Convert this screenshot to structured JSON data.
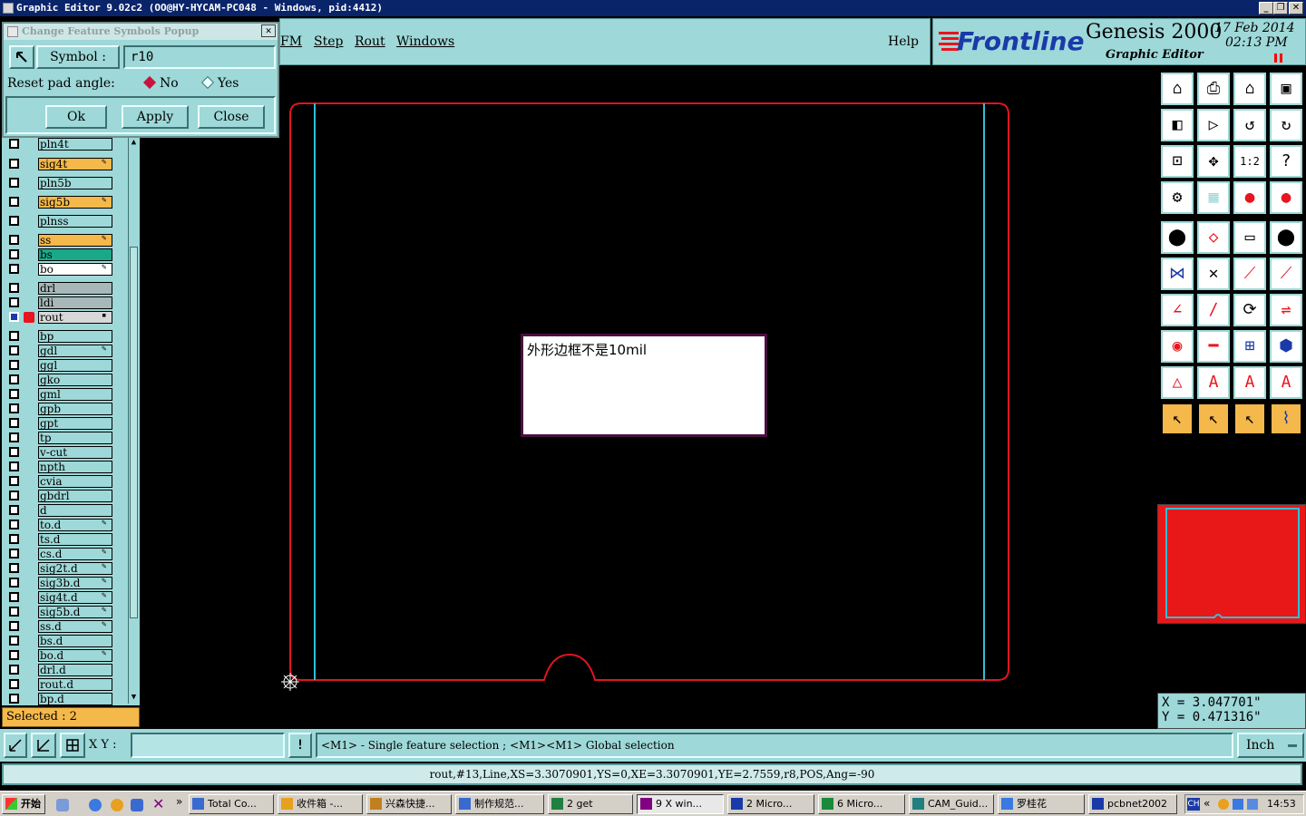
{
  "window": {
    "title": "Graphic Editor 9.02c2 (OO@HY-HYCAM-PC048 - Windows, pid:4412)"
  },
  "menu": {
    "items": [
      "FM",
      "Step",
      "Rout",
      "Windows"
    ],
    "help": "Help"
  },
  "brand": {
    "logo": "Frontline",
    "product": "Genesis 2000",
    "subtitle": "Graphic Editor",
    "date": "17 Feb 2014",
    "time": "02:13 PM"
  },
  "popup": {
    "title": "Change Feature Symbols Popup",
    "symbol_label": "Symbol :",
    "symbol_value": "r10",
    "reset_label": "Reset pad angle:",
    "opt_no": "No",
    "opt_yes": "Yes",
    "ok": "Ok",
    "apply": "Apply",
    "close": "Close"
  },
  "layers": [
    {
      "name": "pln4t",
      "color": "#9ed8d8",
      "flag": ""
    },
    {
      "name": "sig4t",
      "color": "#f5b84a",
      "flag": "✎"
    },
    {
      "name": "pln5b",
      "color": "#9ed8d8",
      "flag": ""
    },
    {
      "name": "sig5b",
      "color": "#f5b84a",
      "flag": "✎"
    },
    {
      "name": "plnss",
      "color": "#9ed8d8",
      "flag": ""
    },
    {
      "name": "ss",
      "color": "#f5b84a",
      "flag": "✎"
    },
    {
      "name": "bs",
      "color": "#1aa88a",
      "flag": ""
    },
    {
      "name": "bo",
      "color": "#ffffff",
      "flag": "✎"
    },
    {
      "name": "drl",
      "color": "#a8b8b8",
      "flag": ""
    },
    {
      "name": "ldi",
      "color": "#a8b8b8",
      "flag": ""
    },
    {
      "name": "rout",
      "color": "#d8d8d8",
      "flag": "▪"
    },
    {
      "name": "bp",
      "color": "#9ed8d8",
      "flag": ""
    },
    {
      "name": "gdl",
      "color": "#9ed8d8",
      "flag": "✎"
    },
    {
      "name": "ggl",
      "color": "#9ed8d8",
      "flag": ""
    },
    {
      "name": "gko",
      "color": "#9ed8d8",
      "flag": ""
    },
    {
      "name": "gml",
      "color": "#9ed8d8",
      "flag": ""
    },
    {
      "name": "gpb",
      "color": "#9ed8d8",
      "flag": ""
    },
    {
      "name": "gpt",
      "color": "#9ed8d8",
      "flag": ""
    },
    {
      "name": "tp",
      "color": "#9ed8d8",
      "flag": ""
    },
    {
      "name": "v-cut",
      "color": "#9ed8d8",
      "flag": ""
    },
    {
      "name": "npth",
      "color": "#9ed8d8",
      "flag": ""
    },
    {
      "name": "cvia",
      "color": "#9ed8d8",
      "flag": ""
    },
    {
      "name": "gbdrl",
      "color": "#9ed8d8",
      "flag": ""
    },
    {
      "name": "d",
      "color": "#9ed8d8",
      "flag": ""
    },
    {
      "name": "to.d",
      "color": "#9ed8d8",
      "flag": "✎"
    },
    {
      "name": "ts.d",
      "color": "#9ed8d8",
      "flag": ""
    },
    {
      "name": "cs.d",
      "color": "#9ed8d8",
      "flag": "✎"
    },
    {
      "name": "sig2t.d",
      "color": "#9ed8d8",
      "flag": "✎"
    },
    {
      "name": "sig3b.d",
      "color": "#9ed8d8",
      "flag": "✎"
    },
    {
      "name": "sig4t.d",
      "color": "#9ed8d8",
      "flag": "✎"
    },
    {
      "name": "sig5b.d",
      "color": "#9ed8d8",
      "flag": "✎"
    },
    {
      "name": "ss.d",
      "color": "#9ed8d8",
      "flag": "✎"
    },
    {
      "name": "bs.d",
      "color": "#9ed8d8",
      "flag": ""
    },
    {
      "name": "bo.d",
      "color": "#9ed8d8",
      "flag": "✎"
    },
    {
      "name": "drl.d",
      "color": "#9ed8d8",
      "flag": ""
    },
    {
      "name": "rout.d",
      "color": "#9ed8d8",
      "flag": ""
    },
    {
      "name": "bp.d",
      "color": "#9ed8d8",
      "flag": ""
    }
  ],
  "selected": "Selected : 2",
  "message_box": {
    "text": "外形边框不是10mil"
  },
  "coords": {
    "x": "X = 3.047701\"",
    "y": "Y = 0.471316\""
  },
  "bottom": {
    "xy_label": "X Y :",
    "xy_value": "",
    "hint": "<M1> - Single feature selection ; <M1><M1> Global selection",
    "units": "Inch"
  },
  "status": "rout,#13,Line,XS=3.3070901,YS=0,XE=3.3070901,YE=2.7559,r8,POS,Ang=-90",
  "taskbar": {
    "start": "开始",
    "tasks": [
      "Total Co...",
      "收件箱 -...",
      "兴森快捷...",
      "制作规范...",
      "2 get",
      "9 X win...",
      "2 Micro...",
      "6 Micro...",
      "CAM_Guid...",
      "罗桂花",
      "pcbnet2002"
    ],
    "tray_lang": "CH",
    "clock": "14:53"
  },
  "colors": {
    "panel": "#9ed8d8",
    "board_outline": "#e0141e",
    "rout_line": "#2fc0d8",
    "accent_red": "#ff0000"
  }
}
